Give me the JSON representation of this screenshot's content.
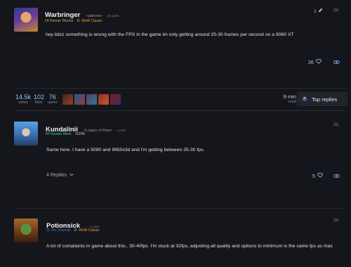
{
  "posts": [
    {
      "author": "Warbringer",
      "guild": "<jabronis>",
      "post_count": "28 posts",
      "race_class": "60 Human Warrior",
      "achievement": "0",
      "game": "WoW Classic",
      "age": "2d",
      "body": "hey blizz something is wrong with the FPS in the game im only getting around 25-30 frames per second on a 9060 XT",
      "likes": "26",
      "post_number": "1"
    },
    {
      "author": "Kundalinii",
      "guild": "<Legacy of Khan>",
      "post_count": "1 post",
      "race_class": "60 Human Monk",
      "achievement": "22245",
      "age": "2d",
      "body": "Same here. I have a 5090 and 9950x3d and I'm getting between 25-30 fps.",
      "replies": "4 Replies",
      "likes": "5"
    },
    {
      "author": "Potionsick",
      "post_count": "1 post",
      "race_class": "11 Orc Shaman",
      "achievement": "0",
      "game": "WoW Classic",
      "age": "2d",
      "body": "A lot of complaints in game about this.. 30-40fps. I'm stuck at 32fps, adjusting all quality and options to minimum is the same fps as max"
    }
  ],
  "topic_stats": {
    "views_num": "14.5k",
    "views_lbl": "views",
    "likes_num": "102",
    "likes_lbl": "likes",
    "users_num": "76",
    "users_lbl": "users",
    "read_num": "9 min",
    "read_lbl": "read",
    "top_replies": "Top replies"
  },
  "icons": {
    "like": "heart-icon",
    "link": "link-icon",
    "edit": "pencil-icon",
    "replies": "chevron-down-icon",
    "top_replies": "layers-icon"
  },
  "colors": {
    "background": "#15161b",
    "accent": "#7bb7f0",
    "warrior": "#c9a56a",
    "monk": "#3fd08c",
    "shaman": "#3d7ad8",
    "classic": "#e6a02a"
  }
}
